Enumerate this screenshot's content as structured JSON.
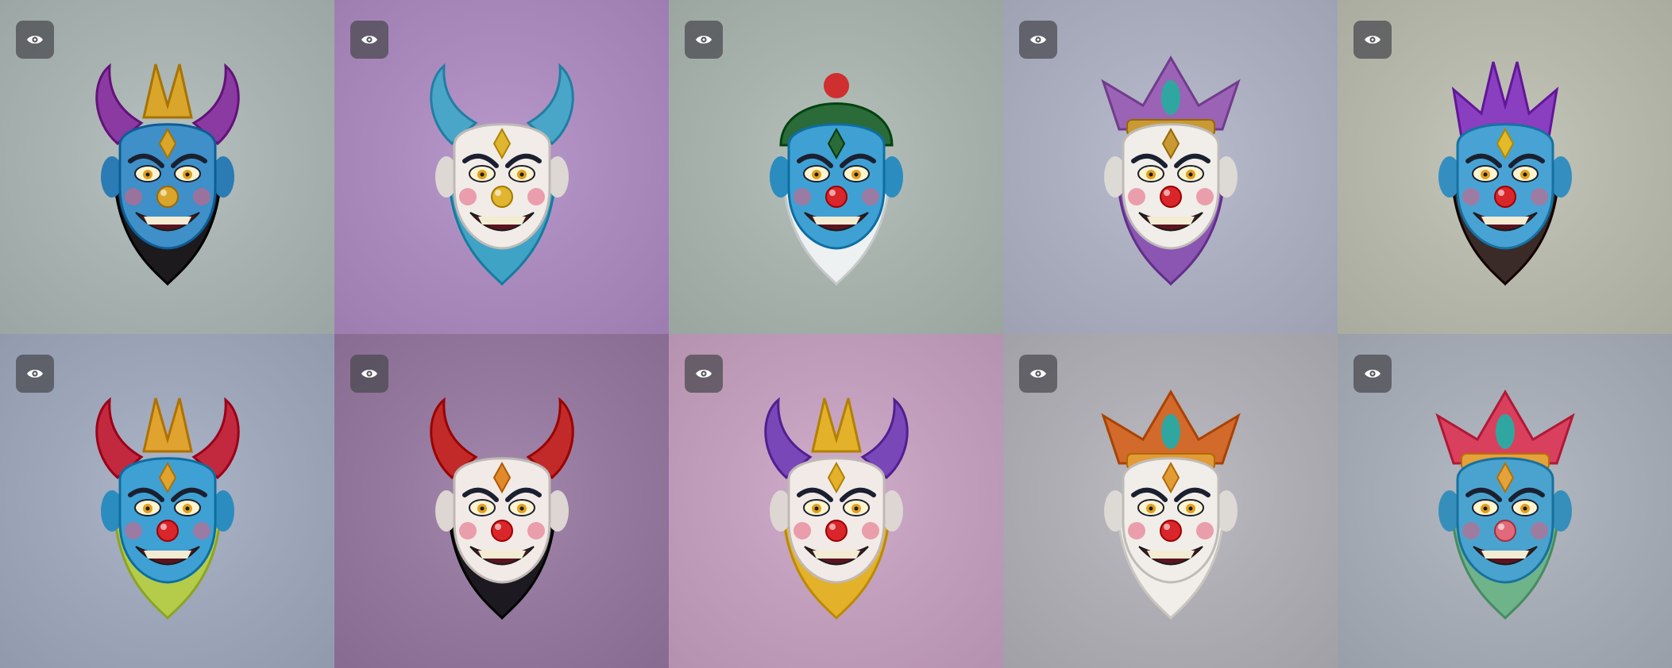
{
  "gallery": {
    "tiles": [
      {
        "bg": "#a9b3b1",
        "skin": "#3f8fc8",
        "accent": "#d9a52a",
        "horn": "#8a3aa0",
        "horn_style": "curl",
        "beard": "#1d1a1d",
        "nose": "#d9a52a",
        "icon": "eye-icon"
      },
      {
        "bg": "#ab8bbd",
        "skin": "#f1ece8",
        "accent": "#e0b52f",
        "horn": "#4aa6c9",
        "horn_style": "long",
        "beard": "#3fa3c6",
        "nose": "#e0b52f",
        "icon": "eye-icon"
      },
      {
        "bg": "#a9b3ad",
        "skin": "#3fa0d4",
        "accent": "#2b6a39",
        "horn": "#cf2f2f",
        "horn_style": "cap",
        "beard": "#eef1f2",
        "nose": "#d8262a",
        "icon": "eye-icon"
      },
      {
        "bg": "#abafbf",
        "skin": "#f1ede9",
        "accent": "#c99a34",
        "horn": "#9a63b6",
        "horn_style": "crown",
        "beard": "#8a56b2",
        "nose": "#d8262a",
        "icon": "eye-icon"
      },
      {
        "bg": "#b7b9ad",
        "skin": "#48a3d4",
        "accent": "#e2ba2a",
        "horn": "#8a3ec0",
        "horn_style": "spikes",
        "beard": "#3a2a28",
        "nose": "#d8262a",
        "icon": "eye-icon"
      },
      {
        "bg": "#9fa7bb",
        "skin": "#3fa0d4",
        "accent": "#e0a330",
        "horn": "#c2293f",
        "horn_style": "jester",
        "beard": "#b5cc4a",
        "nose": "#d8262a",
        "icon": "eye-icon"
      },
      {
        "bg": "#95799e",
        "skin": "#f1eae7",
        "accent": "#e08a2a",
        "horn": "#c22a2a",
        "horn_style": "long",
        "beard": "#1c1a20",
        "nose": "#d8262a",
        "icon": "eye-icon"
      },
      {
        "bg": "#c29fbd",
        "skin": "#f1eae7",
        "accent": "#e4b22a",
        "horn": "#7a47b8",
        "horn_style": "jester",
        "beard": "#e4b22a",
        "nose": "#d8262a",
        "icon": "eye-icon"
      },
      {
        "bg": "#aeaeb4",
        "skin": "#f1ede9",
        "accent": "#e29b35",
        "horn": "#d26a2c",
        "horn_style": "crown",
        "beard": "#f1ede9",
        "nose": "#d8262a",
        "icon": "eye-icon"
      },
      {
        "bg": "#a7adb6",
        "skin": "#4aa3cf",
        "accent": "#e5a23a",
        "horn": "#d9405e",
        "horn_style": "crown",
        "beard": "#6fb38a",
        "nose": "#e06a7a",
        "icon": "eye-icon"
      }
    ]
  }
}
